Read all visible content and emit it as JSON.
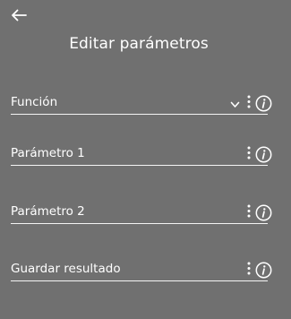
{
  "header": {
    "back_icon": "arrow-left-icon",
    "title": "Editar parámetros"
  },
  "fields": [
    {
      "label": "Función",
      "has_dropdown": true
    },
    {
      "label": "Parámetro 1",
      "has_dropdown": false
    },
    {
      "label": "Parámetro 2",
      "has_dropdown": false
    },
    {
      "label": "Guardar resultado",
      "has_dropdown": false
    }
  ],
  "icons": {
    "dropdown": "chevron-down-icon",
    "menu": "more-vertical-icon",
    "info": "info-icon"
  },
  "colors": {
    "background": "#707070",
    "foreground": "#ffffff"
  }
}
